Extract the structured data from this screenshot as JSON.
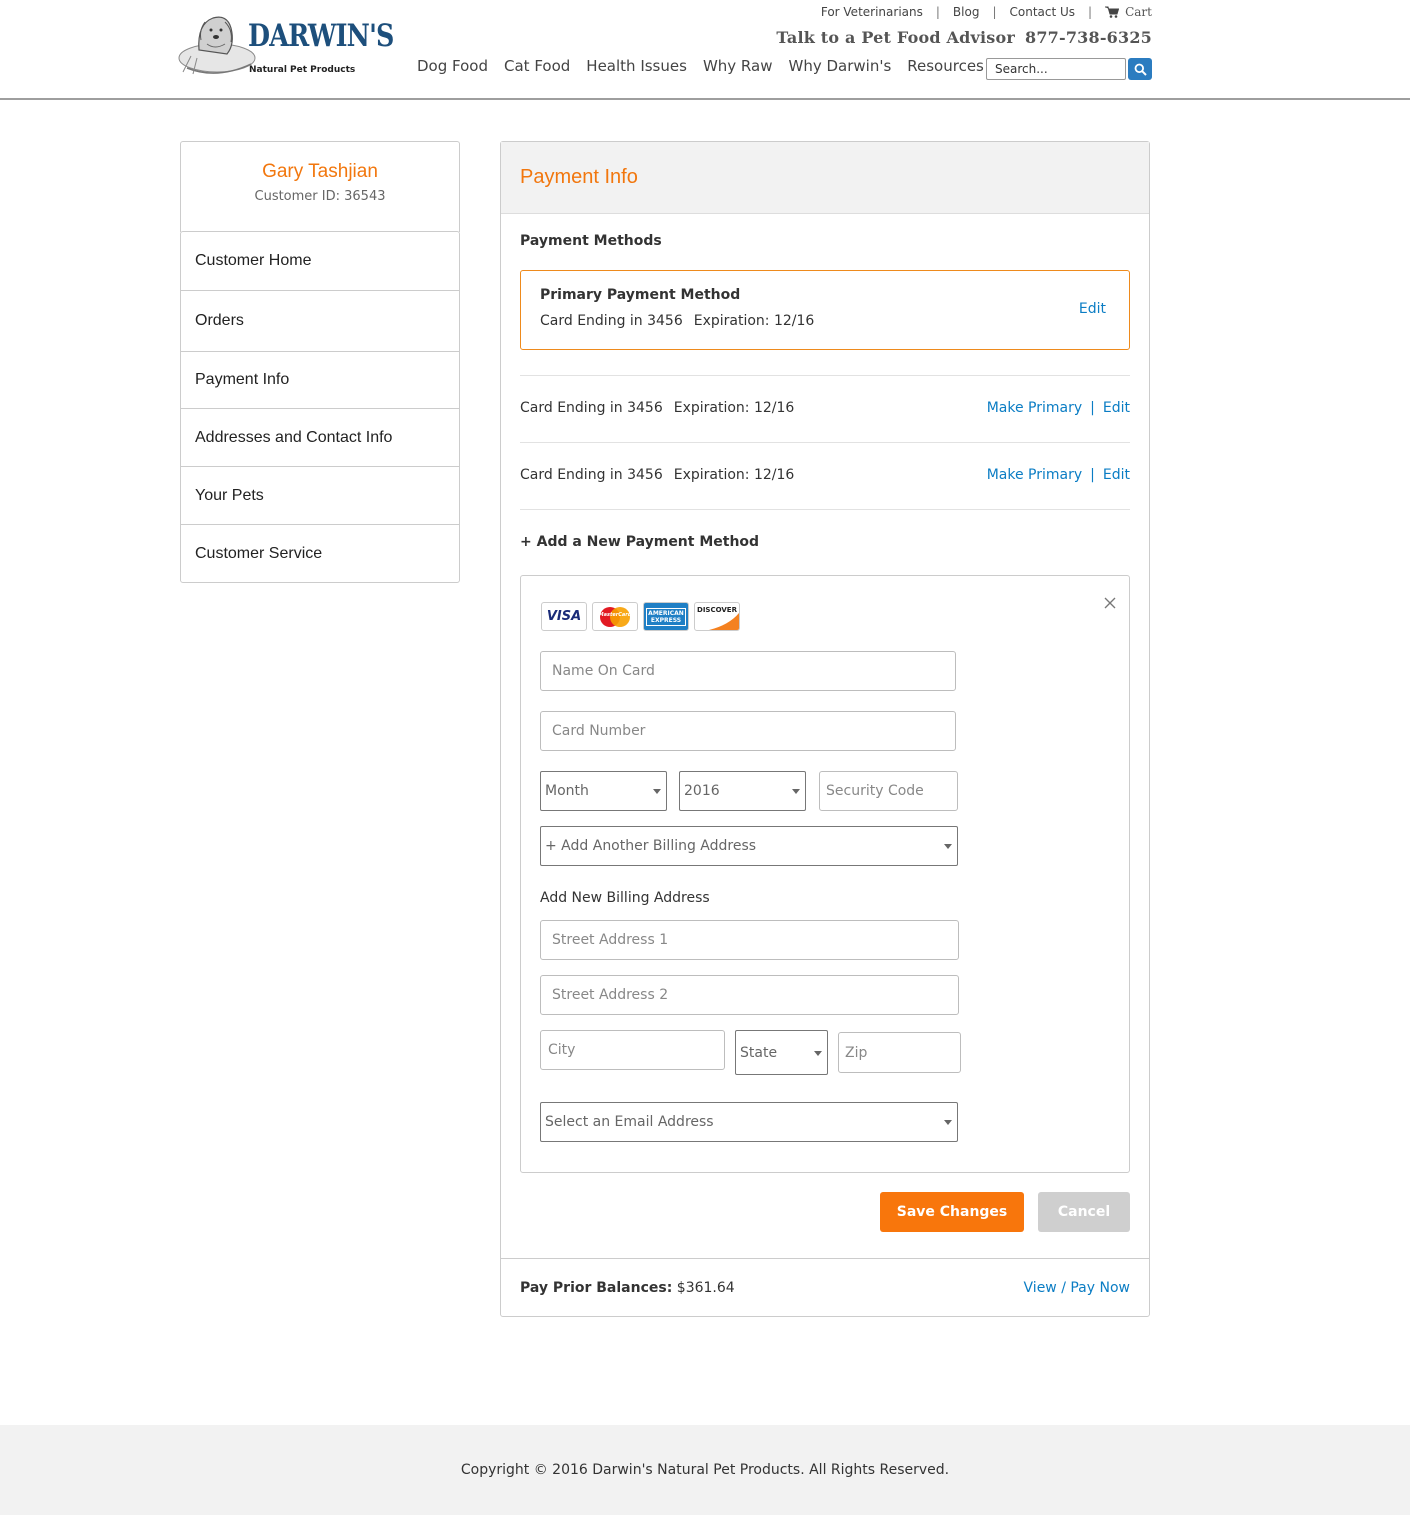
{
  "header": {
    "logo_wordmark": "DARWIN'S",
    "logo_tagline": "Natural Pet Products",
    "top_links": [
      "For Veterinarians",
      "Blog",
      "Contact Us"
    ],
    "cart_label": "Cart",
    "advisor_text": "Talk to a Pet Food Advisor",
    "phone": "877-738-6325",
    "nav": [
      "Dog Food",
      "Cat Food",
      "Health Issues",
      "Why Raw",
      "Why Darwin's",
      "Resources"
    ],
    "search_placeholder": "Search..."
  },
  "sidebar": {
    "customer_name": "Gary Tashjian",
    "customer_id": "Customer ID: 36543",
    "items": [
      {
        "label": "Customer Home"
      },
      {
        "label": "Orders"
      },
      {
        "label": "Payment Info"
      },
      {
        "label": "Addresses and Contact Info"
      },
      {
        "label": "Your Pets"
      },
      {
        "label": "Customer Service"
      }
    ]
  },
  "main": {
    "title": "Payment Info",
    "methods_heading": "Payment Methods",
    "primary": {
      "heading": "Primary Payment Method",
      "card": "Card Ending in 3456",
      "expiration": "Expiration: 12/16",
      "edit_label": "Edit"
    },
    "other_cards": [
      {
        "card": "Card Ending in 3456",
        "expiration": "Expiration: 12/16",
        "make_primary": "Make Primary",
        "separator": "|",
        "edit": "Edit"
      },
      {
        "card": "Card Ending in 3456",
        "expiration": "Expiration: 12/16",
        "make_primary": "Make Primary",
        "separator": "|",
        "edit": "Edit"
      }
    ],
    "add_new_heading": "+ Add a New Payment Method",
    "card_brands": [
      "VISA",
      "MasterCard",
      "AMERICAN EXPRESS",
      "DISCOVER"
    ],
    "form": {
      "name_placeholder": "Name On Card",
      "number_placeholder": "Card Number",
      "month_value": "Month",
      "year_value": "2016",
      "security_placeholder": "Security Code",
      "billing_select": "+ Add Another Billing Address",
      "billing_heading": "Add New Billing Address",
      "street1_placeholder": "Street Address 1",
      "street2_placeholder": "Street Address 2",
      "city_placeholder": "City",
      "state_value": "State",
      "zip_placeholder": "Zip",
      "email_select": "Select an Email Address"
    },
    "save_label": "Save Changes",
    "cancel_label": "Cancel",
    "balance_label": "Pay Prior Balances:",
    "balance_value": "$361.64",
    "view_pay_label": "View / Pay Now"
  },
  "footer": {
    "copyright": "Copyright © 2016 Darwin's Natural Pet Products. All Rights Reserved."
  },
  "colors": {
    "accent_orange": "#f2770e",
    "link_blue": "#0b7dc4",
    "search_button": "#2b7cc0",
    "cancel_gray": "#cfcfcf"
  }
}
